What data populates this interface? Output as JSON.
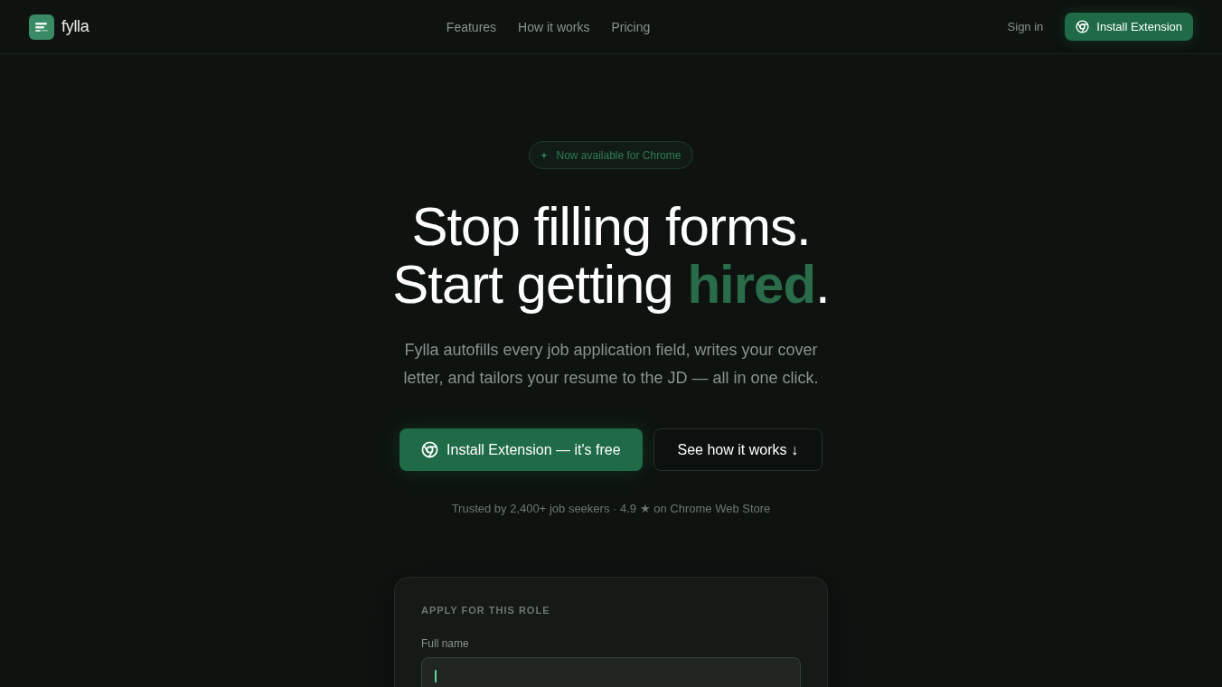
{
  "header": {
    "logo_text": "fylla",
    "nav": [
      {
        "label": "Features"
      },
      {
        "label": "How it works"
      },
      {
        "label": "Pricing"
      }
    ],
    "sign_in": "Sign in",
    "cta": "Install Extension"
  },
  "hero": {
    "badge": "Now available for Chrome",
    "headline": [
      "Stop filling forms.",
      "Start getting **hired**."
    ],
    "subtitle": "Fylla autofills every job application field, writes your cover letter, and tailors your resume to the JD — all in one click.",
    "primary_button": "Install Extension — it's free",
    "secondary_button": "See how it works ↓",
    "trust_line": "Trusted by 2,400+ job seekers · 4.9 ★ on Chrome Web Store"
  },
  "form_card": {
    "heading": "APPLY FOR THIS ROLE",
    "fields": [
      {
        "label": "Full name",
        "focused": true
      }
    ]
  }
}
